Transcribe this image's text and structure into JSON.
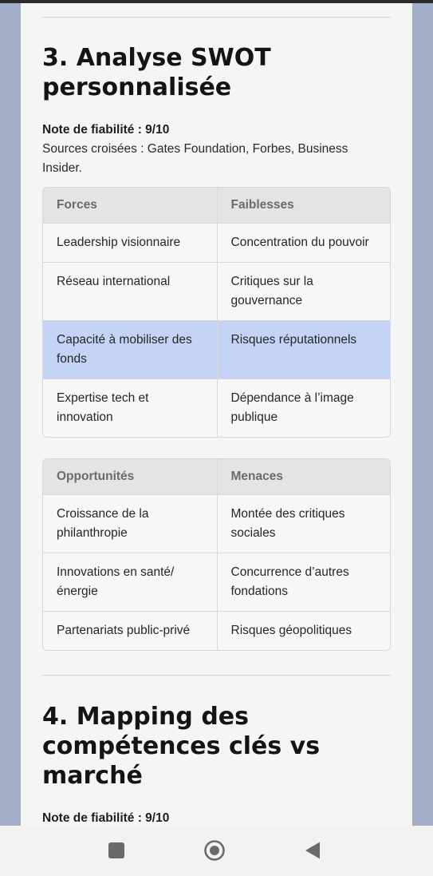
{
  "section3": {
    "title": "3. Analyse SWOT personnalisée",
    "reliability": "Note de fiabilité : 9/10",
    "sources": "Sources croisées : Gates Foundation, Forbes, Business Insider.",
    "table1": {
      "headers": [
        "Forces",
        "Faiblesses"
      ],
      "rows": [
        [
          "Leadership visionnaire",
          "Concentration du pouvoir"
        ],
        [
          "Réseau international",
          "Critiques sur la gouvernance"
        ],
        [
          "Capacité à mobiliser des fonds",
          "Risques réputationnels"
        ],
        [
          "Expertise tech et innovation",
          "Dépendance à l’image publique"
        ]
      ]
    },
    "table2": {
      "headers": [
        "Opportunités",
        "Menaces"
      ],
      "rows": [
        [
          "Croissance de la philanthropie",
          "Montée des critiques sociales"
        ],
        [
          "Innovations en santé/ énergie",
          "Concurrence d’autres fondations"
        ],
        [
          "Partenariats public-privé",
          "Risques géopolitiques"
        ]
      ]
    }
  },
  "section4": {
    "title": "4. Mapping des compétences clés vs marché",
    "reliability": "Note de fiabilité : 9/10"
  },
  "colors": {
    "page_background": "#f5f5f5",
    "side_background": "#a3afc9",
    "highlight_row": "#c5d3f6",
    "table_header": "#e4e4e4"
  },
  "navbar": {
    "icons": [
      "recent-apps-icon",
      "home-icon",
      "back-icon"
    ]
  }
}
